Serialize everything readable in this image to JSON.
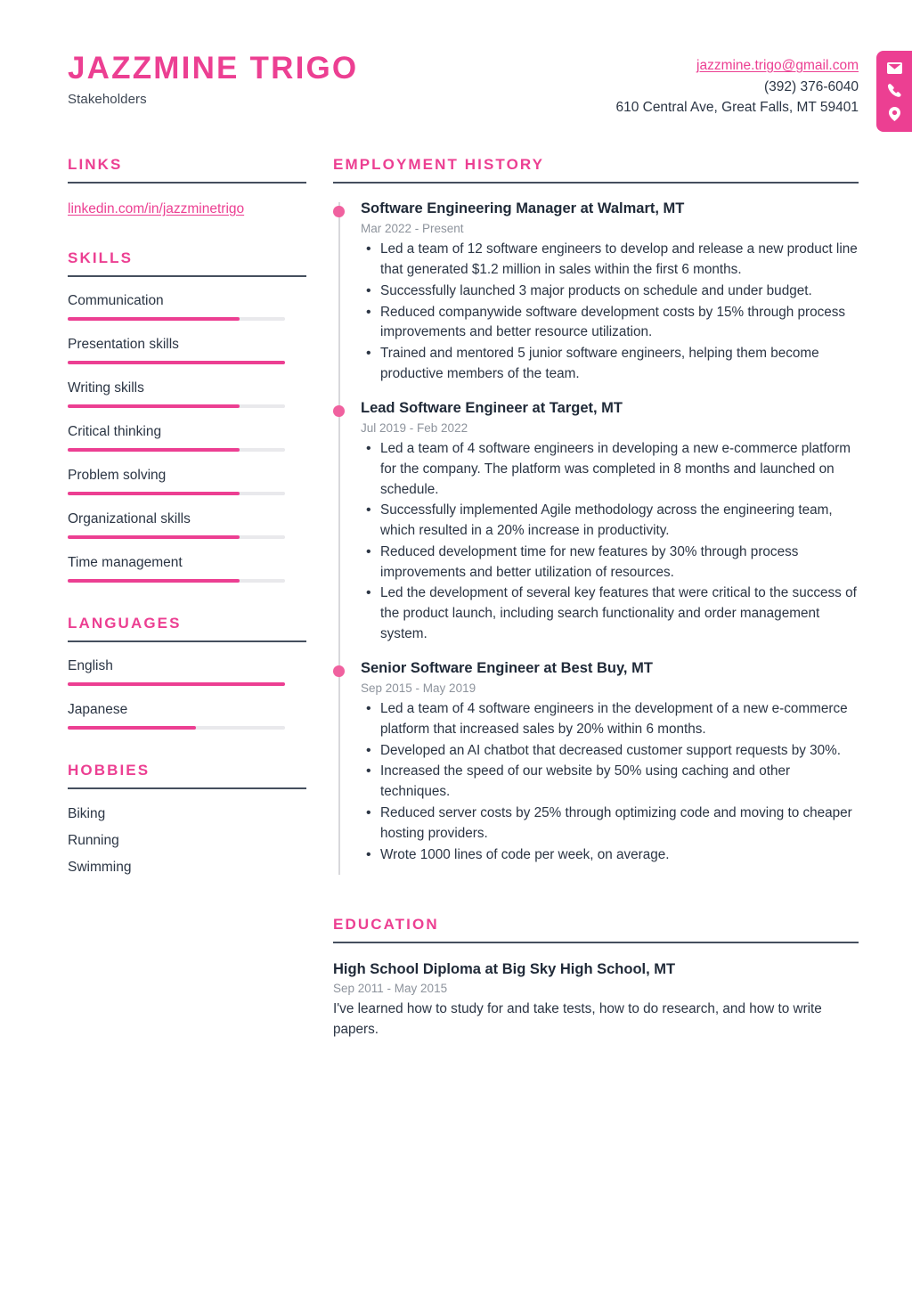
{
  "theme": {
    "accent": "#ec3f92",
    "text": "#2b3544",
    "muted": "#8d939c",
    "rule": "#454f5e",
    "track": "#e9e9ec",
    "timeline": "#d8d8dc"
  },
  "header": {
    "name": "JAZZMINE TRIGO",
    "job_title": "Stakeholders",
    "contact": {
      "email": "jazzmine.trigo@gmail.com",
      "phone": "(392) 376-6040",
      "address": "610 Central Ave, Great Falls, MT 59401"
    },
    "icons": [
      "envelope-icon",
      "phone-icon",
      "location-pin-icon"
    ]
  },
  "sidebar": {
    "links": {
      "title": "LINKS",
      "items": [
        {
          "label": "linkedin.com/in/jazzminetrigo"
        }
      ]
    },
    "skills": {
      "title": "SKILLS",
      "items": [
        {
          "label": "Communication",
          "level": 79
        },
        {
          "label": "Presentation skills",
          "level": 100
        },
        {
          "label": "Writing skills",
          "level": 79
        },
        {
          "label": "Critical thinking",
          "level": 79
        },
        {
          "label": "Problem solving",
          "level": 79
        },
        {
          "label": "Organizational skills",
          "level": 79
        },
        {
          "label": "Time management",
          "level": 79
        }
      ]
    },
    "languages": {
      "title": "LANGUAGES",
      "items": [
        {
          "label": "English",
          "level": 100
        },
        {
          "label": "Japanese",
          "level": 59
        }
      ]
    },
    "hobbies": {
      "title": "HOBBIES",
      "items": [
        {
          "label": "Biking"
        },
        {
          "label": "Running"
        },
        {
          "label": "Swimming"
        }
      ]
    }
  },
  "main": {
    "employment": {
      "title": "EMPLOYMENT HISTORY",
      "jobs": [
        {
          "heading": "Software Engineering Manager at Walmart, MT",
          "dates": "Mar 2022 - Present",
          "bullets": [
            "Led a team of 12 software engineers to develop and release a new product line that generated $1.2 million in sales within the first 6 months.",
            "Successfully launched 3 major products on schedule and under budget.",
            "Reduced companywide software development costs by 15% through process improvements and better resource utilization.",
            "Trained and mentored 5 junior software engineers, helping them become productive members of the team."
          ]
        },
        {
          "heading": "Lead Software Engineer at Target, MT",
          "dates": "Jul 2019 - Feb 2022",
          "bullets": [
            "Led a team of 4 software engineers in developing a new e-commerce platform for the company. The platform was completed in 8 months and launched on schedule.",
            "Successfully implemented Agile methodology across the engineering team, which resulted in a 20% increase in productivity.",
            "Reduced development time for new features by 30% through process improvements and better utilization of resources.",
            "Led the development of several key features that were critical to the success of the product launch, including search functionality and order management system."
          ]
        },
        {
          "heading": "Senior Software Engineer at Best Buy, MT",
          "dates": "Sep 2015 - May 2019",
          "bullets": [
            "Led a team of 4 software engineers in the development of a new e-commerce platform that increased sales by 20% within 6 months.",
            "Developed an AI chatbot that decreased customer support requests by 30%.",
            "Increased the speed of our website by 50% using caching and other techniques.",
            "Reduced server costs by 25% through optimizing code and moving to cheaper hosting providers.",
            "Wrote 1000 lines of code per week, on average."
          ]
        }
      ]
    },
    "education": {
      "title": "EDUCATION",
      "entries": [
        {
          "heading": "High School Diploma at Big Sky High School, MT",
          "dates": "Sep 2011 - May 2015",
          "description": "I've learned how to study for and take tests, how to do research, and how to write papers."
        }
      ]
    }
  }
}
